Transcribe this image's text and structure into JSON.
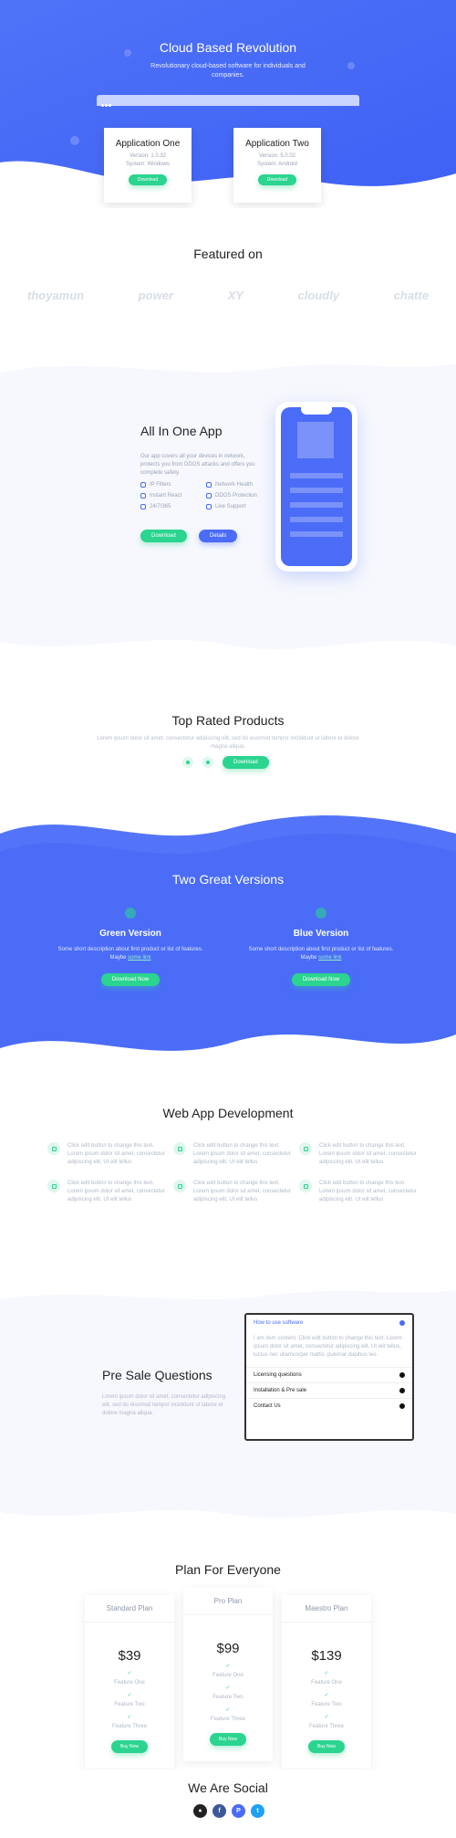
{
  "hero": {
    "title": "Cloud Based Revolution",
    "subtitle": "Revolutionary cloud-based software for individuals and companies.",
    "apps": [
      {
        "name": "Application One",
        "version": "Version: 1.0.32",
        "system": "System: Windows",
        "button": "Download"
      },
      {
        "name": "Application Two",
        "version": "Version: 5.0.02",
        "system": "System: Android",
        "button": "Download"
      }
    ]
  },
  "featured": {
    "title": "Featured on",
    "logos": [
      "thoyamun",
      "power",
      "XY",
      "cloudly",
      "chatte"
    ]
  },
  "allinone": {
    "title": "All In One App",
    "text": "Our app covers all your devices in network, protects you from DDOS attacks and offers you complete safety.",
    "features": [
      "IP Filters",
      "Network Health",
      "Instant React",
      "DDOS Protection",
      "24/7/365",
      "Live Support"
    ],
    "btn_download": "Download",
    "btn_details": "Details"
  },
  "toprated": {
    "title": "Top Rated Products",
    "text": "Lorem ipsum dolor sit amet, consectetur adipiscing elit, sed do eiusmod tempor incididunt ut labore et dolore magna aliqua.",
    "button": "Download"
  },
  "versions": {
    "title": "Two Great Versions",
    "items": [
      {
        "name": "Green Version",
        "text": "Some short description about first product or list of features. Maybe",
        "link": "some link",
        "button": "Download Now"
      },
      {
        "name": "Blue Version",
        "text": "Some short description about first product or list of features. Maybe",
        "link": "some link",
        "button": "Download Now"
      }
    ]
  },
  "webapp": {
    "title": "Web App Development",
    "items": [
      "Click edit button to change this text. Lorem ipsum dolor sit amet, consectetur adipiscing elit. Ut elit tellus",
      "Click edit button to change this text. Lorem ipsum dolor sit amet, consectetur adipiscing elit. Ut elit tellus",
      "Click edit button to change this text. Lorem ipsum dolor sit amet, consectetur adipiscing elit. Ut elit tellus",
      "Click edit button to change this text. Lorem ipsum dolor sit amet, consectetur adipiscing elit. Ut elit tellus",
      "Click edit button to change this text. Lorem ipsum dolor sit amet, consectetur adipiscing elit. Ut elit tellus",
      "Click edit button to change this text. Lorem ipsum dolor sit amet, consectetur adipiscing elit. Ut elit tellus"
    ]
  },
  "presale": {
    "title": "Pre Sale Questions",
    "text": "Lorem ipsum dolor sit amet, consectetur adipiscing elit, sed do eiusmod tempor incididunt ut labore et dolore magna aliqua.",
    "accordion": {
      "open_title": "How to use software",
      "open_body": "I am item content. Click edit button to change this text. Lorem ipsum dolor sit amet, consectetur adipiscing elit. Ut elit tellus, luctus nec ullamcorper mattis, pulvinar dapibus leo.",
      "items": [
        "Licensing questions",
        "Installation & Pre sale",
        "Contact Us"
      ]
    }
  },
  "pricing": {
    "title": "Plan For Everyone",
    "plans": [
      {
        "name": "Standard Plan",
        "price": "$39",
        "features": [
          "Feature One",
          "Feature Two",
          "Feature Three"
        ],
        "button": "Buy Now"
      },
      {
        "name": "Pro Plan",
        "price": "$99",
        "features": [
          "Feature One",
          "Feature Two",
          "Feature Three"
        ],
        "button": "Buy Now"
      },
      {
        "name": "Maestro Plan",
        "price": "$139",
        "features": [
          "Feature One",
          "Feature Two",
          "Feature Three"
        ],
        "button": "Buy Now"
      }
    ]
  },
  "social": {
    "title": "We Are Social",
    "icons": [
      "github-icon",
      "facebook-icon",
      "paypal-icon",
      "twitter-icon"
    ],
    "colors": [
      "#222222",
      "#3b5998",
      "#4a6cf7",
      "#1da1f2"
    ]
  },
  "colors": {
    "brand_blue": "#4a6cf7",
    "brand_green": "#2bd48f"
  }
}
